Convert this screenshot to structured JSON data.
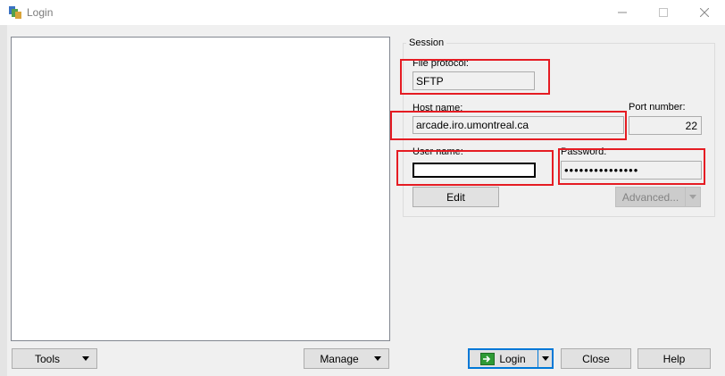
{
  "window": {
    "title": "Login"
  },
  "left_buttons": {
    "tools": "Tools",
    "manage": "Manage"
  },
  "session": {
    "group_title": "Session",
    "file_protocol_label": "File protocol:",
    "file_protocol_value": "SFTP",
    "host_label": "Host name:",
    "host_value": "arcade.iro.umontreal.ca",
    "port_label": "Port number:",
    "port_value": "22",
    "user_label": "User name:",
    "user_value": "",
    "password_label": "Password:",
    "password_value": "•••••••••••••••",
    "edit_label": "Edit",
    "advanced_label": "Advanced..."
  },
  "bottom_buttons": {
    "login": "Login",
    "close": "Close",
    "help": "Help"
  },
  "colors": {
    "highlight": "#e51c23",
    "accent": "#0078d7",
    "login_icon": "#2e9a35"
  },
  "icons": [
    "winscp-app-icon",
    "minimize-icon",
    "maximize-icon",
    "close-icon",
    "login-icon",
    "chevron-down-icon"
  ]
}
